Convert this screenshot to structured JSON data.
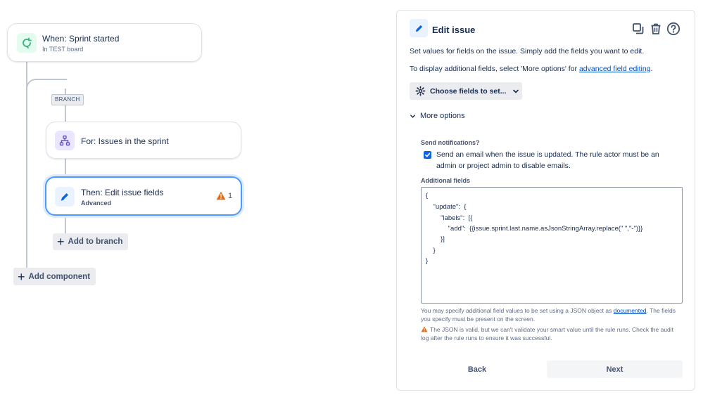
{
  "canvas": {
    "trigger": {
      "title": "When: Sprint started",
      "subtitle": "In TEST board",
      "accent": "#36b37e"
    },
    "branch_tag": "BRANCH",
    "branch_rule": {
      "title": "For: Issues in the sprint",
      "accent": "#6554c0"
    },
    "action": {
      "title": "Then: Edit issue fields",
      "subtitle": "Advanced",
      "warning_count": "1",
      "accent": "#0c66e4"
    },
    "add_to_branch": "Add to branch",
    "add_component": "Add component"
  },
  "panel": {
    "title": "Edit issue",
    "description": "Set values for fields on the issue. Simply add the fields you want to edit.",
    "more_fields_prefix": "To display additional fields, select 'More options' for ",
    "more_fields_link": "advanced field editing",
    "more_fields_suffix": ".",
    "choose_fields_label": "Choose fields to set...",
    "more_options_label": "More options",
    "send_notifications_label": "Send notifications?",
    "send_email_text": "Send an email when the issue is updated. The rule actor must be an admin or project admin to disable emails.",
    "send_email_checked": true,
    "additional_fields_label": "Additional fields",
    "json_lines": [
      "{",
      "    \"update\":  {",
      "        \"labels\":  [{",
      "            \"add\":  {{issue.sprint.last.name.asJsonStringArray.replace(\" \",\"-\")}}",
      "        }]",
      "    }",
      "}"
    ],
    "help_prefix": "You may specify additional field values to be set using a JSON object as ",
    "help_link": "documented",
    "help_suffix": ". The fields you specify must be present on the screen.",
    "warning_text": "The JSON is valid, but we can't validate your smart value until the rule runs. Check the audit log after the rule runs to ensure it was successful.",
    "back_label": "Back",
    "next_label": "Next",
    "icons": [
      "copy-icon",
      "trash-icon",
      "help-icon"
    ],
    "warning_color": "#e56910"
  }
}
